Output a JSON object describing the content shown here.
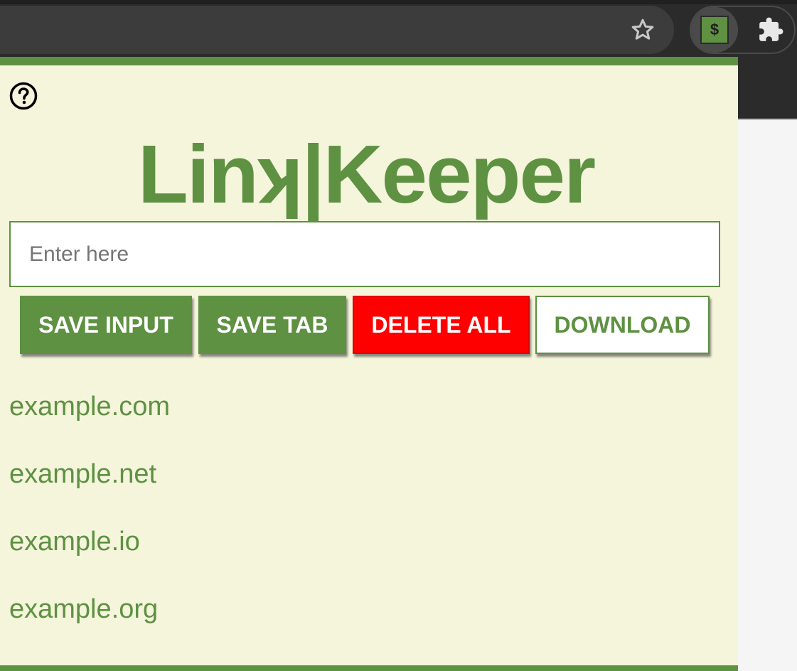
{
  "browser": {
    "bookmark_icon": "star-outline-icon",
    "extension": {
      "icon": "dollar-icon",
      "label": "$"
    },
    "extensions_menu_icon": "puzzle-icon"
  },
  "popup": {
    "help_icon": "question-circle-icon",
    "title": "Linʞ|Keeper",
    "input": {
      "placeholder": "Enter here",
      "value": ""
    },
    "buttons": {
      "save_input": "SAVE INPUT",
      "save_tab": "SAVE TAB",
      "delete_all": "DELETE ALL",
      "download": "DOWNLOAD"
    },
    "links": [
      "example.com",
      "example.net",
      "example.io",
      "example.org"
    ]
  },
  "colors": {
    "brand_green": "#5e9142",
    "background_cream": "#f5f5dc",
    "danger_red": "#ff0000",
    "toolbar_dark": "#2b2b2b"
  }
}
